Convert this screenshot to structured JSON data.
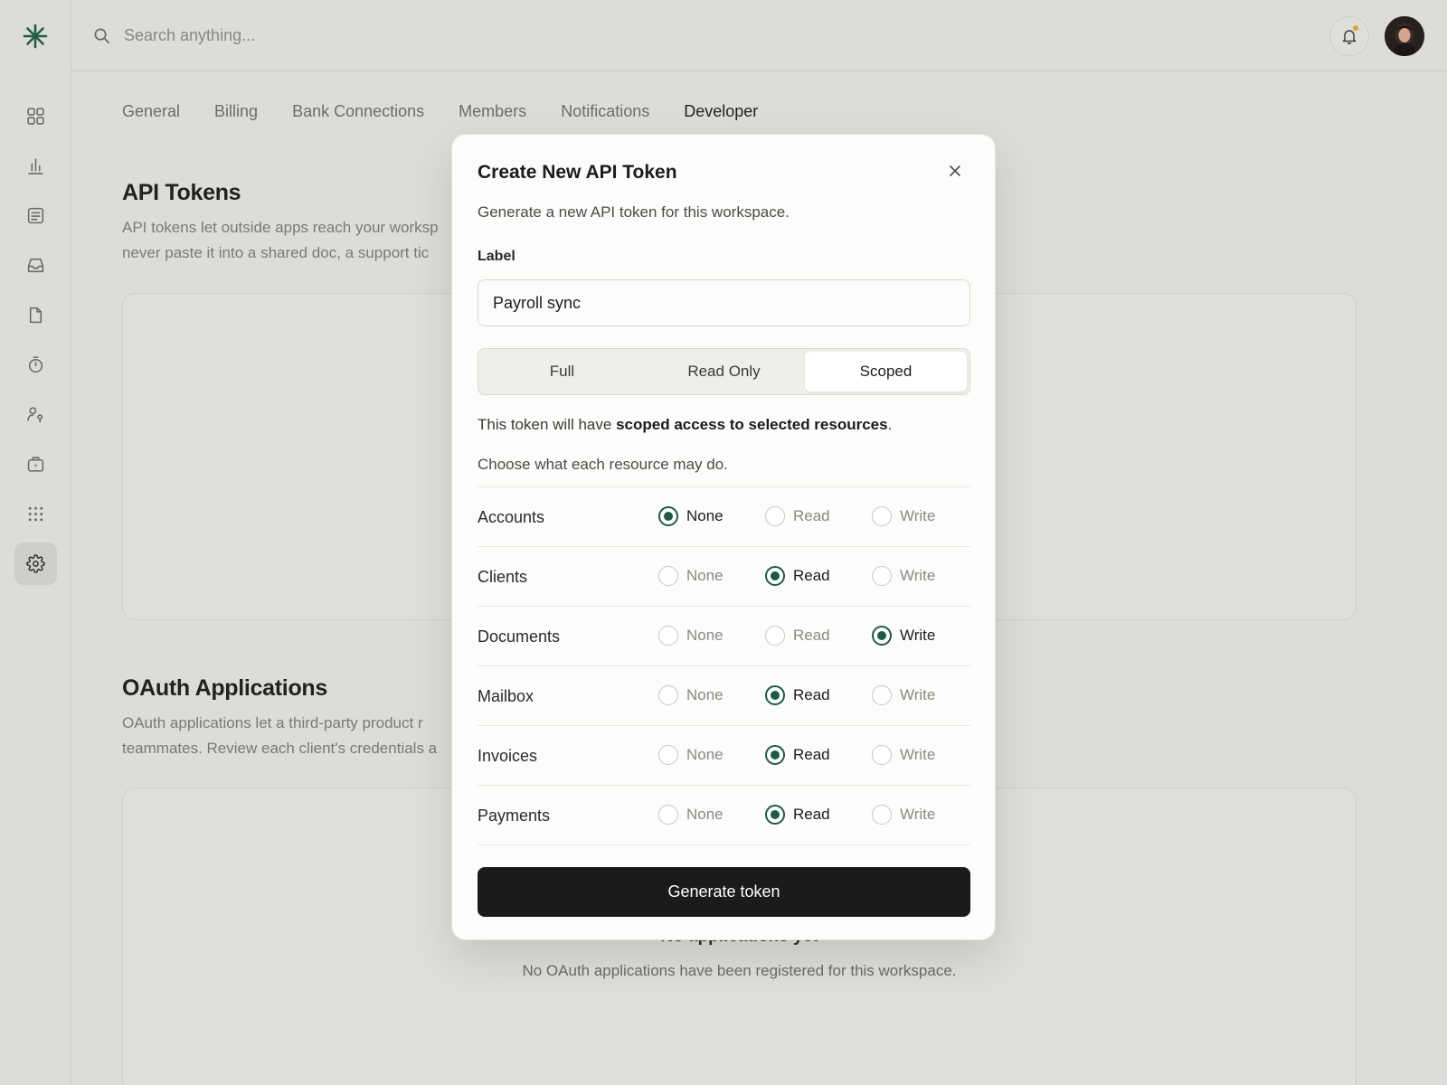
{
  "search": {
    "placeholder": "Search anything..."
  },
  "tabs": [
    {
      "label": "General"
    },
    {
      "label": "Billing"
    },
    {
      "label": "Bank Connections"
    },
    {
      "label": "Members"
    },
    {
      "label": "Notifications"
    },
    {
      "label": "Developer",
      "active": true
    }
  ],
  "api_tokens": {
    "title": "API Tokens",
    "desc_line1": "API tokens let outside apps reach your worksp",
    "desc_line2": "never paste it into a shared doc, a support tic"
  },
  "oauth": {
    "title": "OAuth Applications",
    "desc_line1": "OAuth applications let a third-party product r",
    "desc_line2": "teammates. Review each client's credentials a",
    "empty_title": "No applications yet",
    "empty_desc": "No OAuth applications have been registered for this workspace."
  },
  "modal": {
    "title": "Create New API Token",
    "subtitle": "Generate a new API token for this workspace.",
    "label_field": "Label",
    "label_value": "Payroll sync",
    "segments": [
      "Full",
      "Read Only",
      "Scoped"
    ],
    "active_segment": "Scoped",
    "access_prefix": "This token will have ",
    "access_bold": "scoped access to selected resources",
    "access_suffix": ".",
    "choose_text": "Choose what each resource may do.",
    "option_labels": [
      "None",
      "Read",
      "Write"
    ],
    "permissions": [
      {
        "resource": "Accounts",
        "value": "None"
      },
      {
        "resource": "Clients",
        "value": "Read"
      },
      {
        "resource": "Documents",
        "value": "Write"
      },
      {
        "resource": "Mailbox",
        "value": "Read"
      },
      {
        "resource": "Invoices",
        "value": "Read"
      },
      {
        "resource": "Payments",
        "value": "Read"
      }
    ],
    "submit_label": "Generate token"
  },
  "colors": {
    "accent": "#1e5a44",
    "button": "#1b1b1a",
    "notification_dot": "#e0a83a"
  }
}
